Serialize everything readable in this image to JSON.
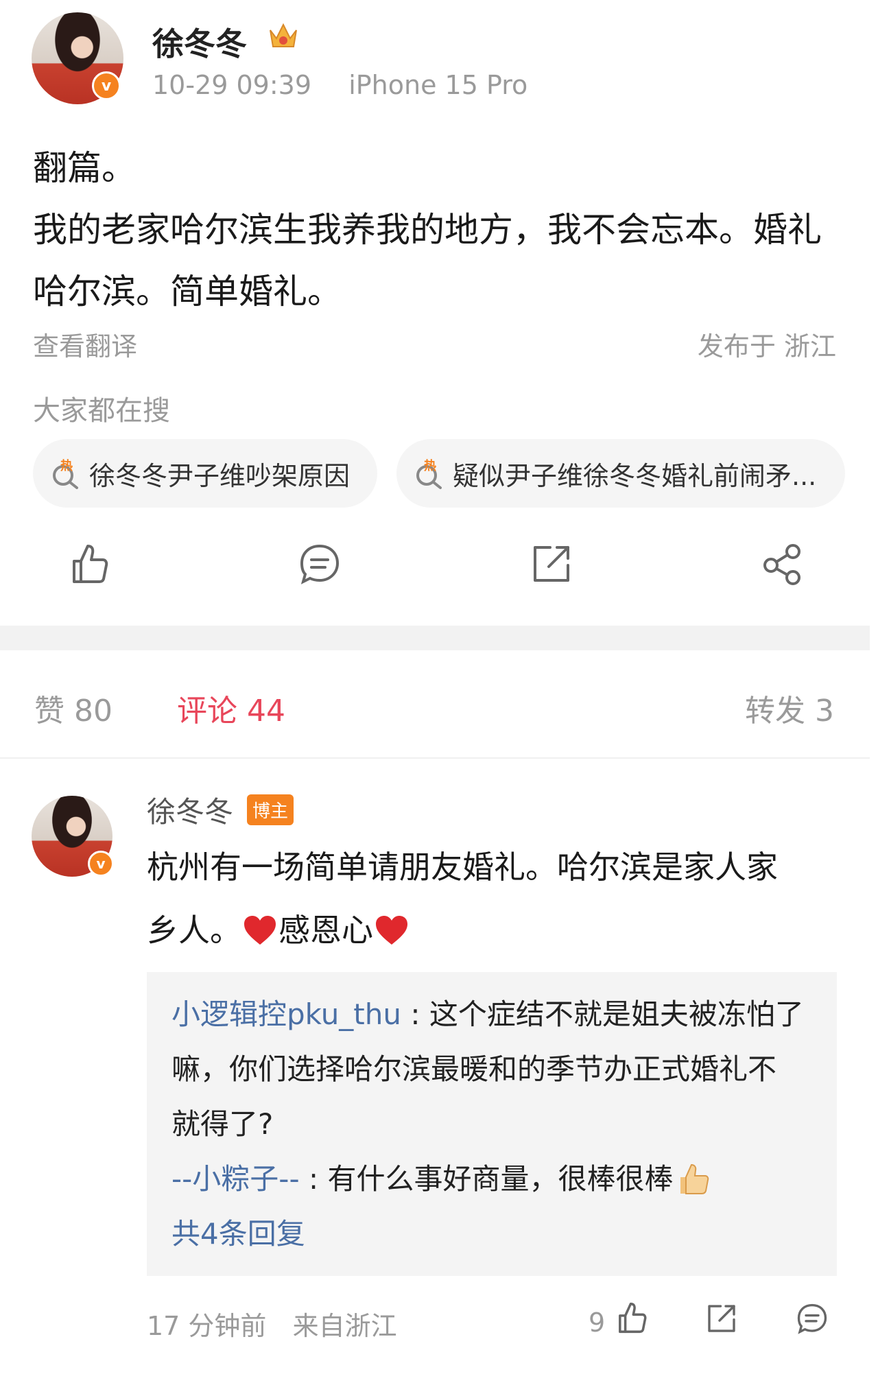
{
  "post": {
    "author": "徐冬冬",
    "badge_v": "v",
    "time": "10-29 09:39",
    "device": "iPhone 15 Pro",
    "text_line1": "翻篇。",
    "text_line2": "我的老家哈尔滨生我养我的地方，我不会忘本。婚礼",
    "text_line3": "哈尔滨。简单婚礼。",
    "translate": "查看翻译",
    "location": "发布于 浙江",
    "hot_search_title": "大家都在搜",
    "hot_searches": [
      "徐冬冬尹子维吵架原因",
      "疑似尹子维徐冬冬婚礼前闹矛..."
    ],
    "hot_label": "热"
  },
  "stats": {
    "likes": "赞 80",
    "comments": "评论 44",
    "reposts": "转发 3"
  },
  "comment": {
    "author": "徐冬冬",
    "badge": "博主",
    "line1": "杭州有一场简单请朋友婚礼。哈尔滨是家人家",
    "line2_a": "乡人。",
    "line2_b": "感恩心",
    "replies": [
      {
        "user": "小逻辑控pku_thu",
        "sep": " : ",
        "text1": "这个症结不就是姐夫被冻怕了",
        "text2": "嘛，你们选择哈尔滨最暖和的季节办正式婚礼不",
        "text3": "就得了?"
      },
      {
        "user": "--小粽子--",
        "sep": " : ",
        "text1": "有什么事好商量，很棒很棒"
      }
    ],
    "more_replies": "共4条回复",
    "time": "17 分钟前",
    "from": "来自浙江",
    "like_count": "9"
  },
  "colors": {
    "accent_red": "#e8465a",
    "link_blue": "#4a6fa5",
    "badge_orange": "#f5821f",
    "gray_text": "#9a9a9a"
  }
}
